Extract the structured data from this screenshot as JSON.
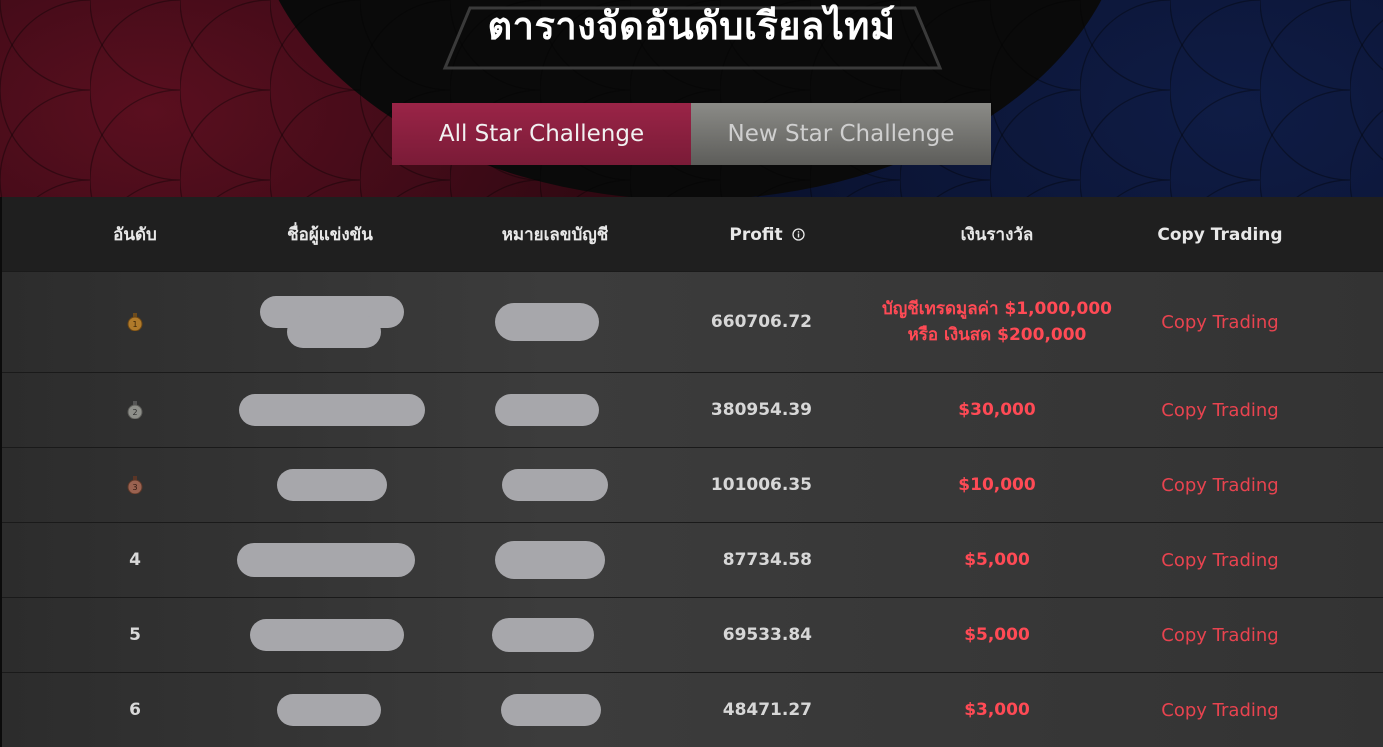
{
  "header": {
    "title": "ตารางจัดอันดับเรียลไทม์",
    "tabs": [
      {
        "label": "All Star Challenge",
        "active": true
      },
      {
        "label": "New Star Challenge",
        "active": false
      }
    ],
    "colors": {
      "active_tab": "#8a1f40",
      "inactive_tab": "#75756f",
      "accent_red": "#ff4a55"
    }
  },
  "table": {
    "columns": [
      "อันดับ",
      "ชื่อผู้แข่งขัน",
      "หมายเลขบัญชี",
      "Profit",
      "เงินรางวัล",
      "Copy Trading"
    ],
    "profit_info_icon": "info-circle-icon",
    "rows": [
      {
        "rank": "1",
        "rank_icon": "gold-medal-icon",
        "profit": "660706.72",
        "prize_line1": "บัญชีเทรดมูลค่า $1,000,000",
        "prize_line2": "หรือ เงินสด $200,000",
        "action": "Copy Trading"
      },
      {
        "rank": "2",
        "rank_icon": "silver-medal-icon",
        "profit": "380954.39",
        "prize_line1": "$30,000",
        "prize_line2": "",
        "action": "Copy Trading"
      },
      {
        "rank": "3",
        "rank_icon": "bronze-medal-icon",
        "profit": "101006.35",
        "prize_line1": "$10,000",
        "prize_line2": "",
        "action": "Copy Trading"
      },
      {
        "rank": "4",
        "rank_icon": "",
        "profit": "87734.58",
        "prize_line1": "$5,000",
        "prize_line2": "",
        "action": "Copy Trading"
      },
      {
        "rank": "5",
        "rank_icon": "",
        "profit": "69533.84",
        "prize_line1": "$5,000",
        "prize_line2": "",
        "action": "Copy Trading"
      },
      {
        "rank": "6",
        "rank_icon": "",
        "profit": "48471.27",
        "prize_line1": "$3,000",
        "prize_line2": "",
        "action": "Copy Trading"
      }
    ]
  }
}
